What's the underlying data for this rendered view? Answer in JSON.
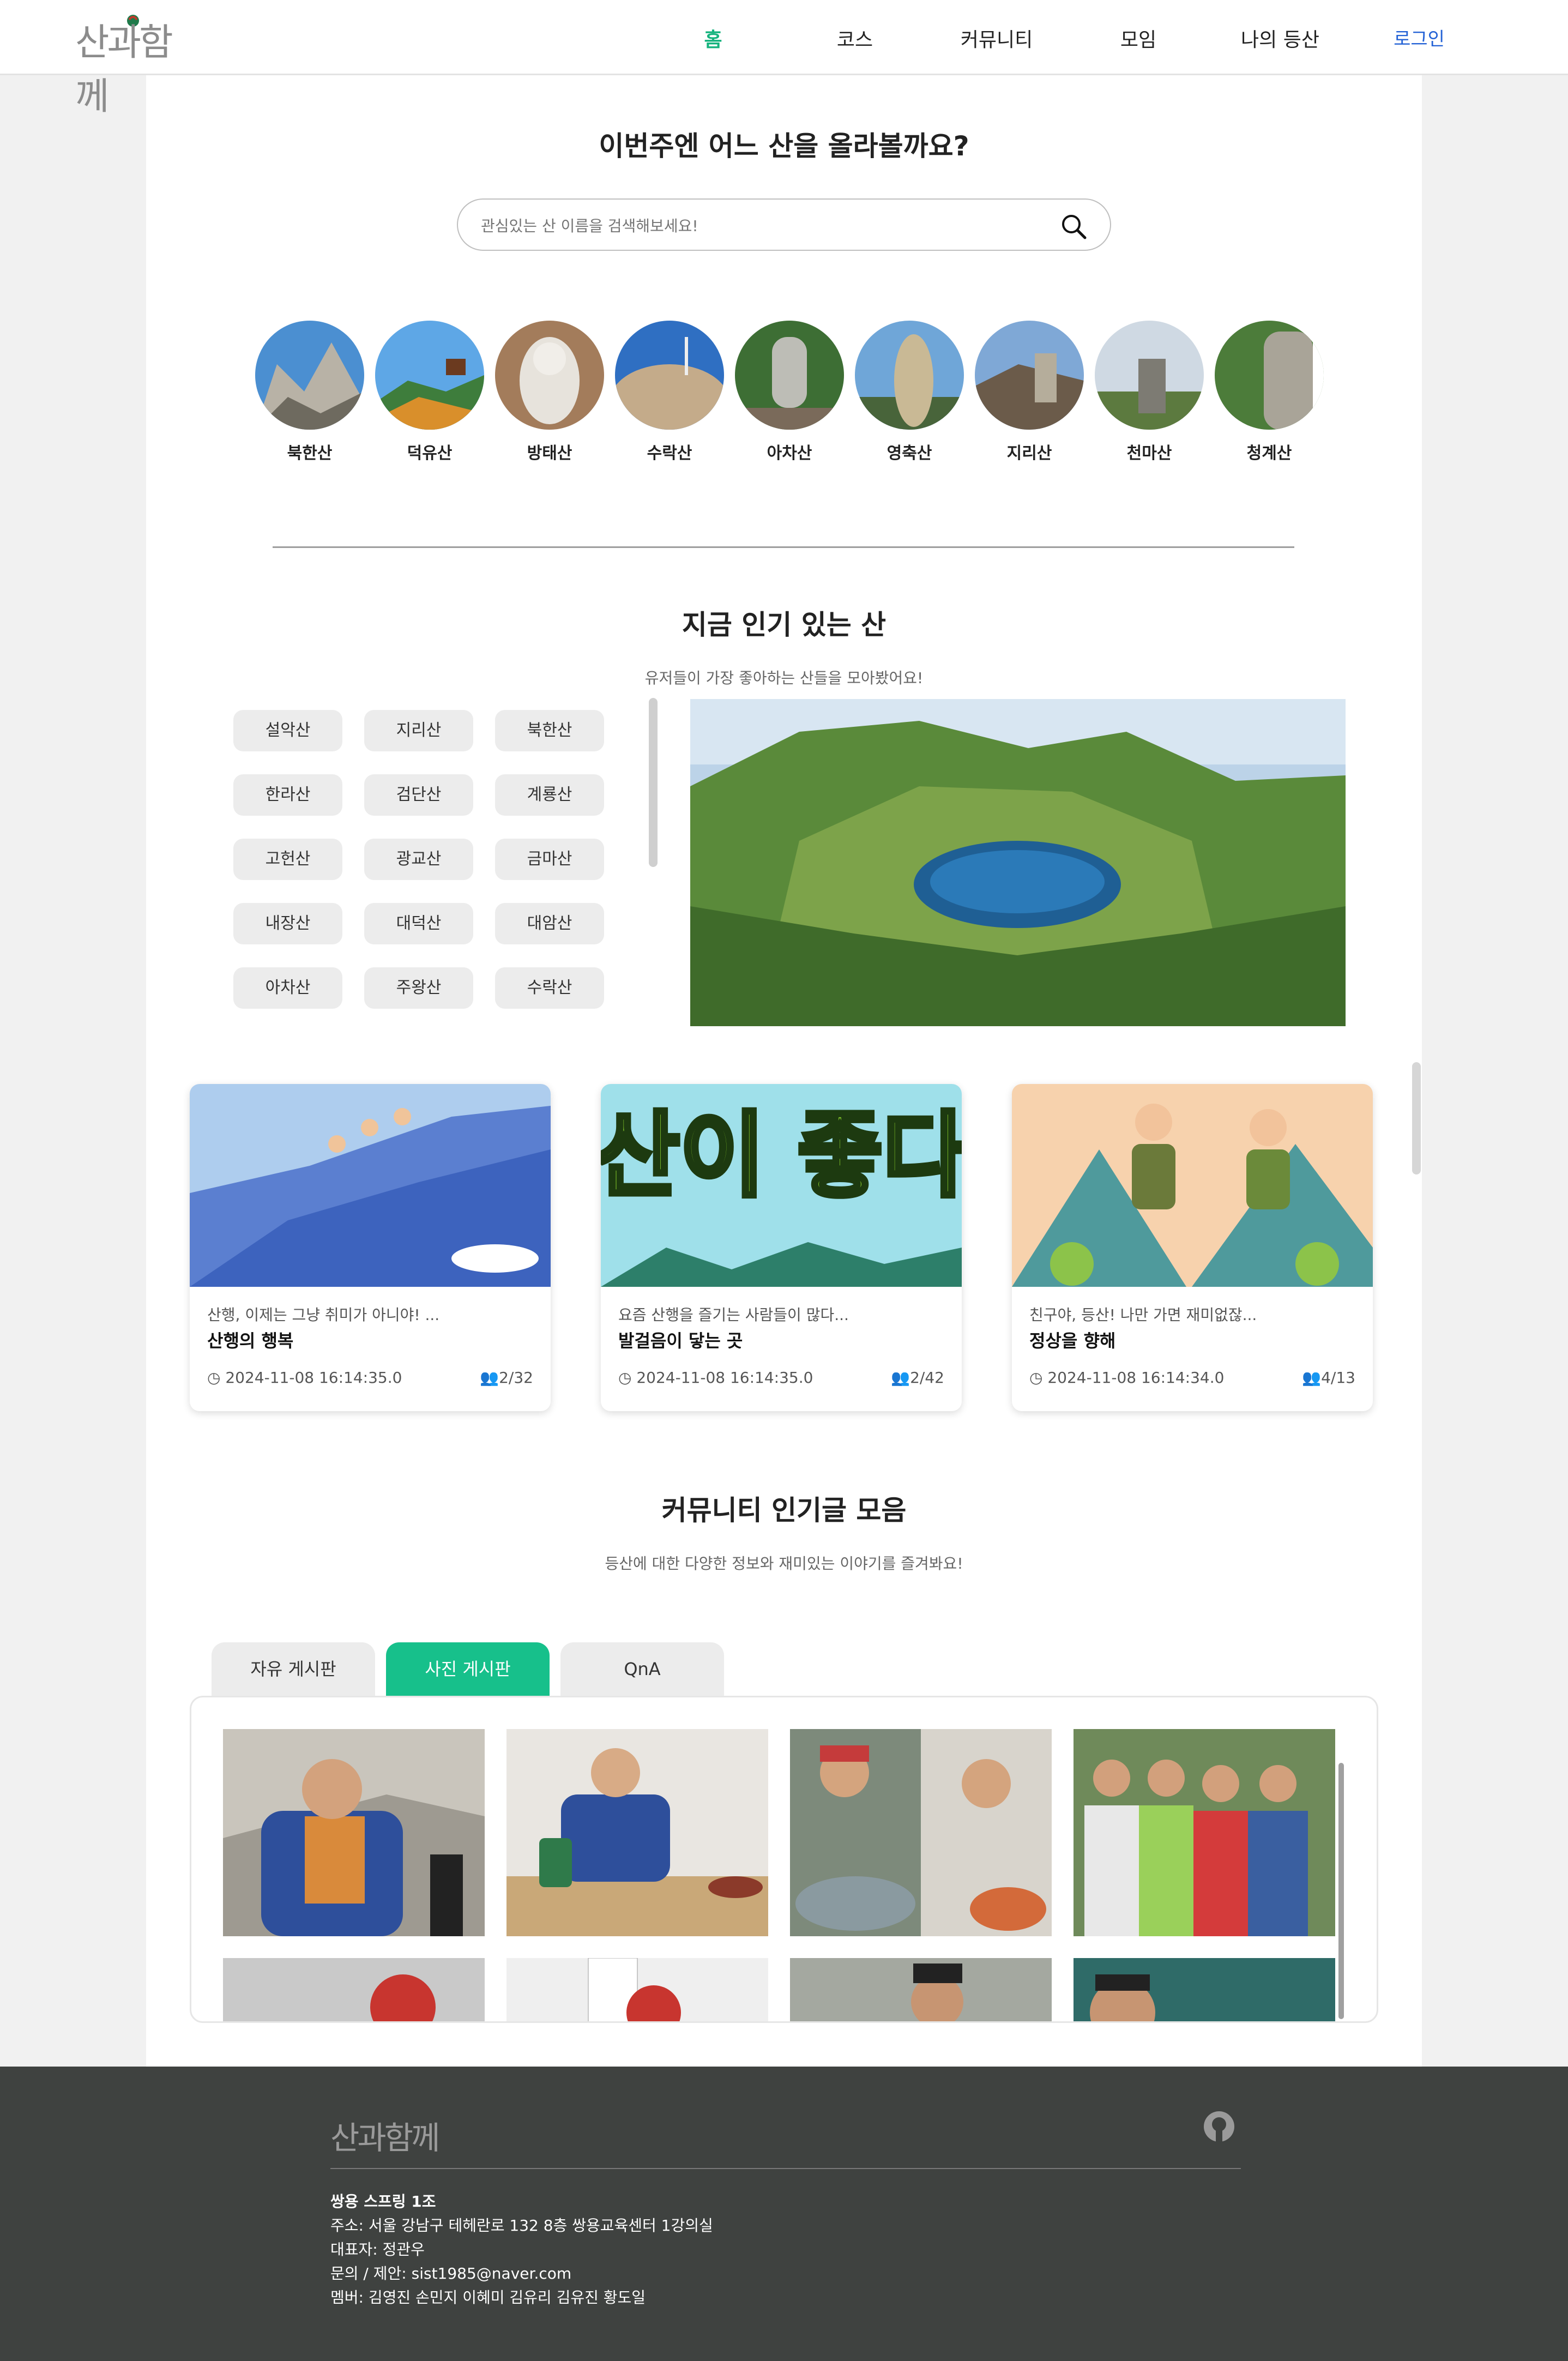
{
  "header": {
    "logo_text": "산과함께",
    "nav": [
      "홈",
      "코스",
      "커뮤니티",
      "모임",
      "나의 등산"
    ],
    "login_label": "로그인",
    "accent_color": "#16b37e",
    "login_color": "#2563d6"
  },
  "hero": {
    "title": "이번주엔 어느 산을 올라볼까요?",
    "search_placeholder": "관심있는 산 이름을 검색해보세요!",
    "search_icon": "search-icon"
  },
  "mountains": [
    "북한산",
    "덕유산",
    "방태산",
    "수락산",
    "아차산",
    "영축산",
    "지리산",
    "천마산",
    "청계산"
  ],
  "popular": {
    "title": "지금 인기 있는 산",
    "subtitle": "유저들이 가장 좋아하는 산들을 모아봤어요!",
    "chips": [
      "설악산",
      "지리산",
      "북한산",
      "한라산",
      "검단산",
      "계룡산",
      "고헌산",
      "광교산",
      "금마산",
      "내장산",
      "대덕산",
      "대암산",
      "아차산",
      "주왕산",
      "수락산"
    ]
  },
  "cards": [
    {
      "subtitle": "산행, 이제는 그냥 취미가 아니야! ...",
      "title": "산행의 행복",
      "date": "2024-11-08 16:14:35.0",
      "count": "2/32"
    },
    {
      "subtitle": "요즘 산행을 즐기는 사람들이 많다...",
      "title": "발걸음이 닿는 곳",
      "date": "2024-11-08 16:14:35.0",
      "count": "2/42",
      "image_text": "산이 좋다"
    },
    {
      "subtitle": "친구야, 등산! 나만 가면 재미없잖...",
      "title": "정상을 향해",
      "date": "2024-11-08 16:14:34.0",
      "count": "4/13"
    }
  ],
  "community": {
    "title": "커뮤니티 인기글 모음",
    "subtitle": "등산에 대한 다양한 정보와 재미있는 이야기를 즐겨봐요!",
    "tabs": [
      "자유 게시판",
      "사진 게시판",
      "QnA"
    ],
    "active_tab": "사진 게시판",
    "tab_active_color": "#17c08b"
  },
  "footer": {
    "logo_text": "산과함께",
    "company": "쌍용 스프링 1조",
    "address": "주소: 서울 강남구 테헤란로 132 8층 쌍용교육센터 1강의실",
    "ceo": "대표자: 정관우",
    "contact": "문의 / 제안: sist1985@naver.com",
    "members": "멤버: 김영진 손민지 이혜미 김유리 김유진 황도일",
    "icon": "github-icon"
  }
}
